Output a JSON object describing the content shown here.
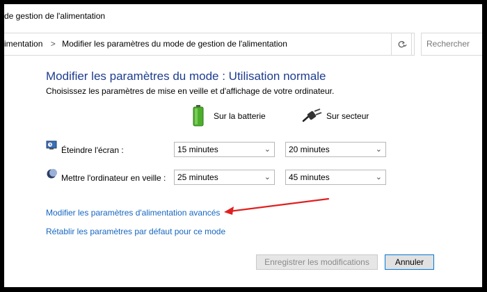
{
  "window": {
    "title": "de gestion de l'alimentation"
  },
  "address": {
    "crumb1": "imentation",
    "separator": ">",
    "crumb2": "Modifier les paramètres du mode de gestion de l'alimentation",
    "search_placeholder": "Rechercher"
  },
  "main": {
    "title": "Modifier les paramètres du mode : Utilisation normale",
    "subtitle": "Choisissez les paramètres de mise en veille et d'affichage de votre ordinateur.",
    "columns": {
      "battery": "Sur la batterie",
      "plugged": "Sur secteur"
    },
    "rows": [
      {
        "label": "Éteindre l'écran :",
        "battery_value": "15 minutes",
        "plugged_value": "20 minutes"
      },
      {
        "label": "Mettre l'ordinateur en veille :",
        "battery_value": "25 minutes",
        "plugged_value": "45 minutes"
      }
    ],
    "links": {
      "advanced": "Modifier les paramètres d'alimentation avancés",
      "restore": "Rétablir les paramètres par défaut pour ce mode"
    }
  },
  "buttons": {
    "save": "Enregistrer les modifications",
    "cancel": "Annuler"
  },
  "colors": {
    "title_blue": "#1e3d8f",
    "link_blue": "#1566c0",
    "annotation_red": "#e02020"
  }
}
